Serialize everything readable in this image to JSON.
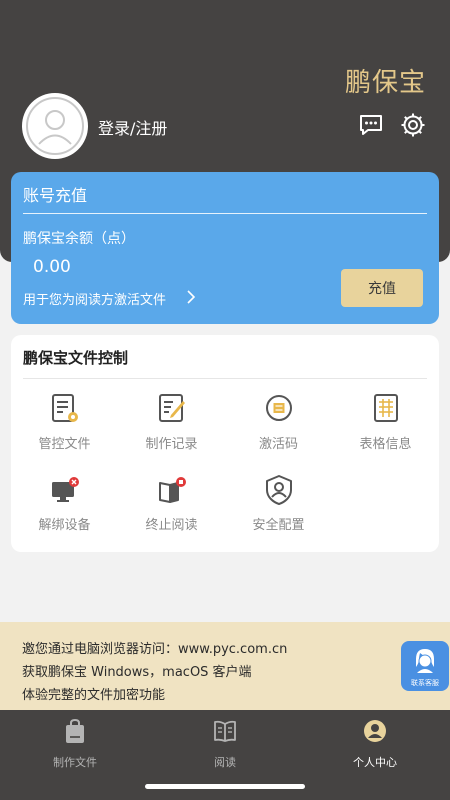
{
  "header": {
    "brand": "鹏保宝",
    "login_label": "登录/注册",
    "icons": [
      "user-avatar-icon",
      "message-icon",
      "settings-gear-icon"
    ],
    "colors": {
      "background": "#454342",
      "brand": "#e4c88a"
    }
  },
  "recharge": {
    "title": "账号充值",
    "balance_label": "鹏保宝余额（点）",
    "balance_value": "0.00",
    "hint": "用于您为阅读方激活文件",
    "button_label": "充值",
    "colors": {
      "card": "#5aa8ea",
      "button": "#e8d39c"
    }
  },
  "file_control": {
    "title": "鹏保宝文件控制",
    "items": [
      {
        "label": "管控文件",
        "icon": "managed-file-icon"
      },
      {
        "label": "制作记录",
        "icon": "make-record-icon"
      },
      {
        "label": "激活码",
        "icon": "activation-code-icon"
      },
      {
        "label": "表格信息",
        "icon": "table-info-icon"
      },
      {
        "label": "解绑设备",
        "icon": "unbind-device-icon"
      },
      {
        "label": "终止阅读",
        "icon": "stop-reading-icon"
      },
      {
        "label": "安全配置",
        "icon": "security-config-icon"
      }
    ]
  },
  "promo": {
    "lines": [
      "邀您通过电脑浏览器访问：www.pyc.com.cn",
      "获取鹏保宝 Windows，macOS 客户端",
      "体验完整的文件加密功能"
    ],
    "customer_service_label": "联系客服"
  },
  "tabbar": {
    "tabs": [
      {
        "label": "制作文件",
        "icon": "make-file-icon",
        "active": false
      },
      {
        "label": "阅读",
        "icon": "book-icon",
        "active": false
      },
      {
        "label": "个人中心",
        "icon": "personal-center-icon",
        "active": true
      }
    ]
  }
}
